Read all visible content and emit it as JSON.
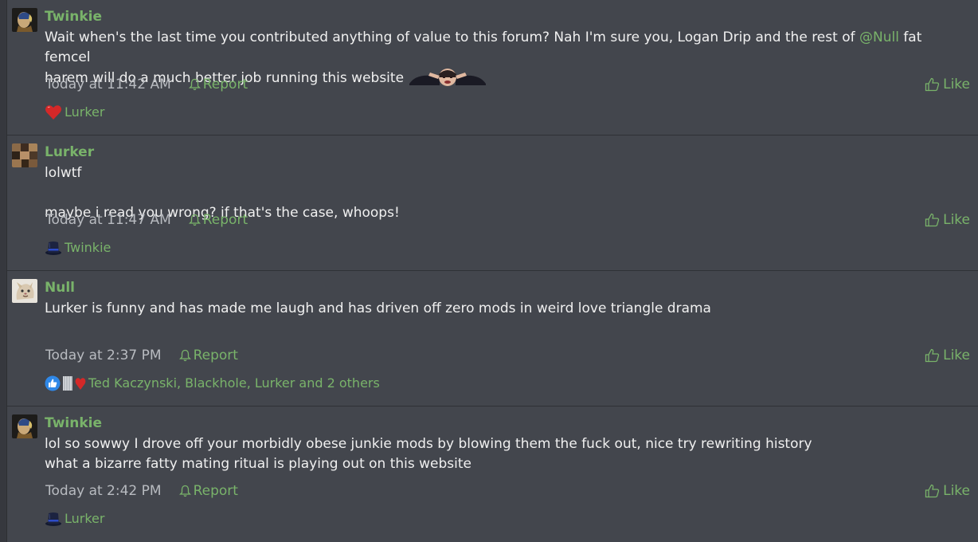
{
  "posts": [
    {
      "username": "Twinkie",
      "avatar": "portrait-avatar",
      "lines": [
        "Wait when's the last time you contributed anything of value to this forum? Nah I'm sure you, Logan Drip and the rest of ",
        "@Null",
        " fat femcel",
        "harem will do a much better job running this website "
      ],
      "smilie": "stressed-face-smilie",
      "timestamp": "Today at 11:42 AM",
      "report_label": "Report",
      "like_label": "Like",
      "reactions": [
        "heart-icon"
      ],
      "reaction_text": "Lurker"
    },
    {
      "username": "Lurker",
      "avatar": "collage-avatar",
      "line1": "lolwtf",
      "line2": "maybe i read you wrong? if that's the case, whoops!",
      "timestamp": "Today at 11:47 AM",
      "report_label": "Report",
      "like_label": "Like",
      "reactions": [
        "top-hat-icon"
      ],
      "reaction_text": "Twinkie"
    },
    {
      "username": "Null",
      "avatar": "cartoon-avatar",
      "line1": "Lurker is funny and has made me laugh and has driven off zero mods in weird love triangle drama",
      "timestamp": "Today at 2:37 PM",
      "report_label": "Report",
      "like_label": "Like",
      "reactions": [
        "thumbs-up-icon",
        "paper-icon",
        "heart-icon"
      ],
      "reaction_text": "Ted Kaczynski, Blackhole, Lurker and 2 others"
    },
    {
      "username": "Twinkie",
      "avatar": "portrait-avatar",
      "line1": "lol so sowwy I drove off your morbidly obese junkie mods by blowing them the fuck out, nice try rewriting history",
      "line2": "what a bizarre fatty mating ritual is playing out on this website",
      "timestamp": "Today at 2:42 PM",
      "report_label": "Report",
      "like_label": "Like",
      "reactions": [
        "top-hat-icon"
      ],
      "reaction_text": "Lurker"
    }
  ],
  "colors": {
    "background": "#43464d",
    "accent_green": "#79b36a",
    "text": "#f0f0f0",
    "meta": "#b8bbc0"
  }
}
